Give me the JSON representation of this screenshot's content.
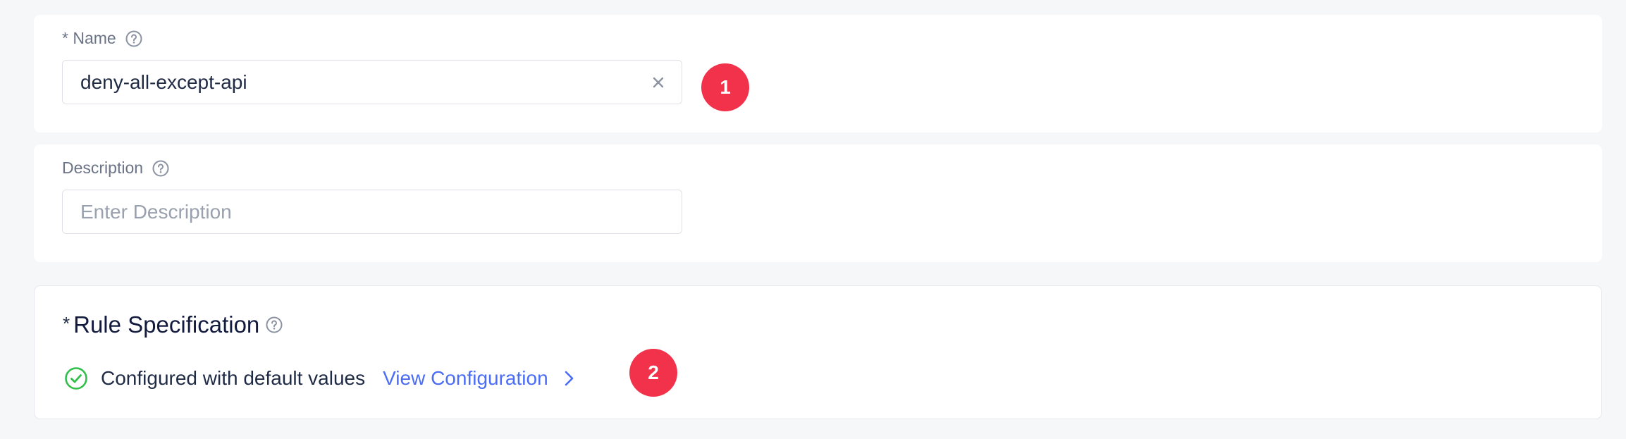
{
  "name_field": {
    "required_marker": "*",
    "label": "Name",
    "value": "deny-all-except-api",
    "help_icon": "question-circle-icon",
    "clear_icon": "close-icon"
  },
  "description_field": {
    "label": "Description",
    "value": "",
    "placeholder": "Enter Description",
    "help_icon": "question-circle-icon"
  },
  "rule_specification": {
    "required_marker": "*",
    "title": "Rule Specification",
    "help_icon": "question-circle-icon",
    "status_icon": "check-circle-icon",
    "status_text": "Configured with default values",
    "link_label": "View Configuration",
    "link_icon": "chevron-right-icon"
  },
  "annotations": [
    {
      "label": "1"
    },
    {
      "label": "2"
    }
  ],
  "colors": {
    "page_background": "#f6f7f9",
    "card_background": "#ffffff",
    "badge": "#f2314a",
    "link": "#4a6cf7",
    "success": "#2fbf4a",
    "label": "#6b7386",
    "text": "#1f2a44"
  }
}
